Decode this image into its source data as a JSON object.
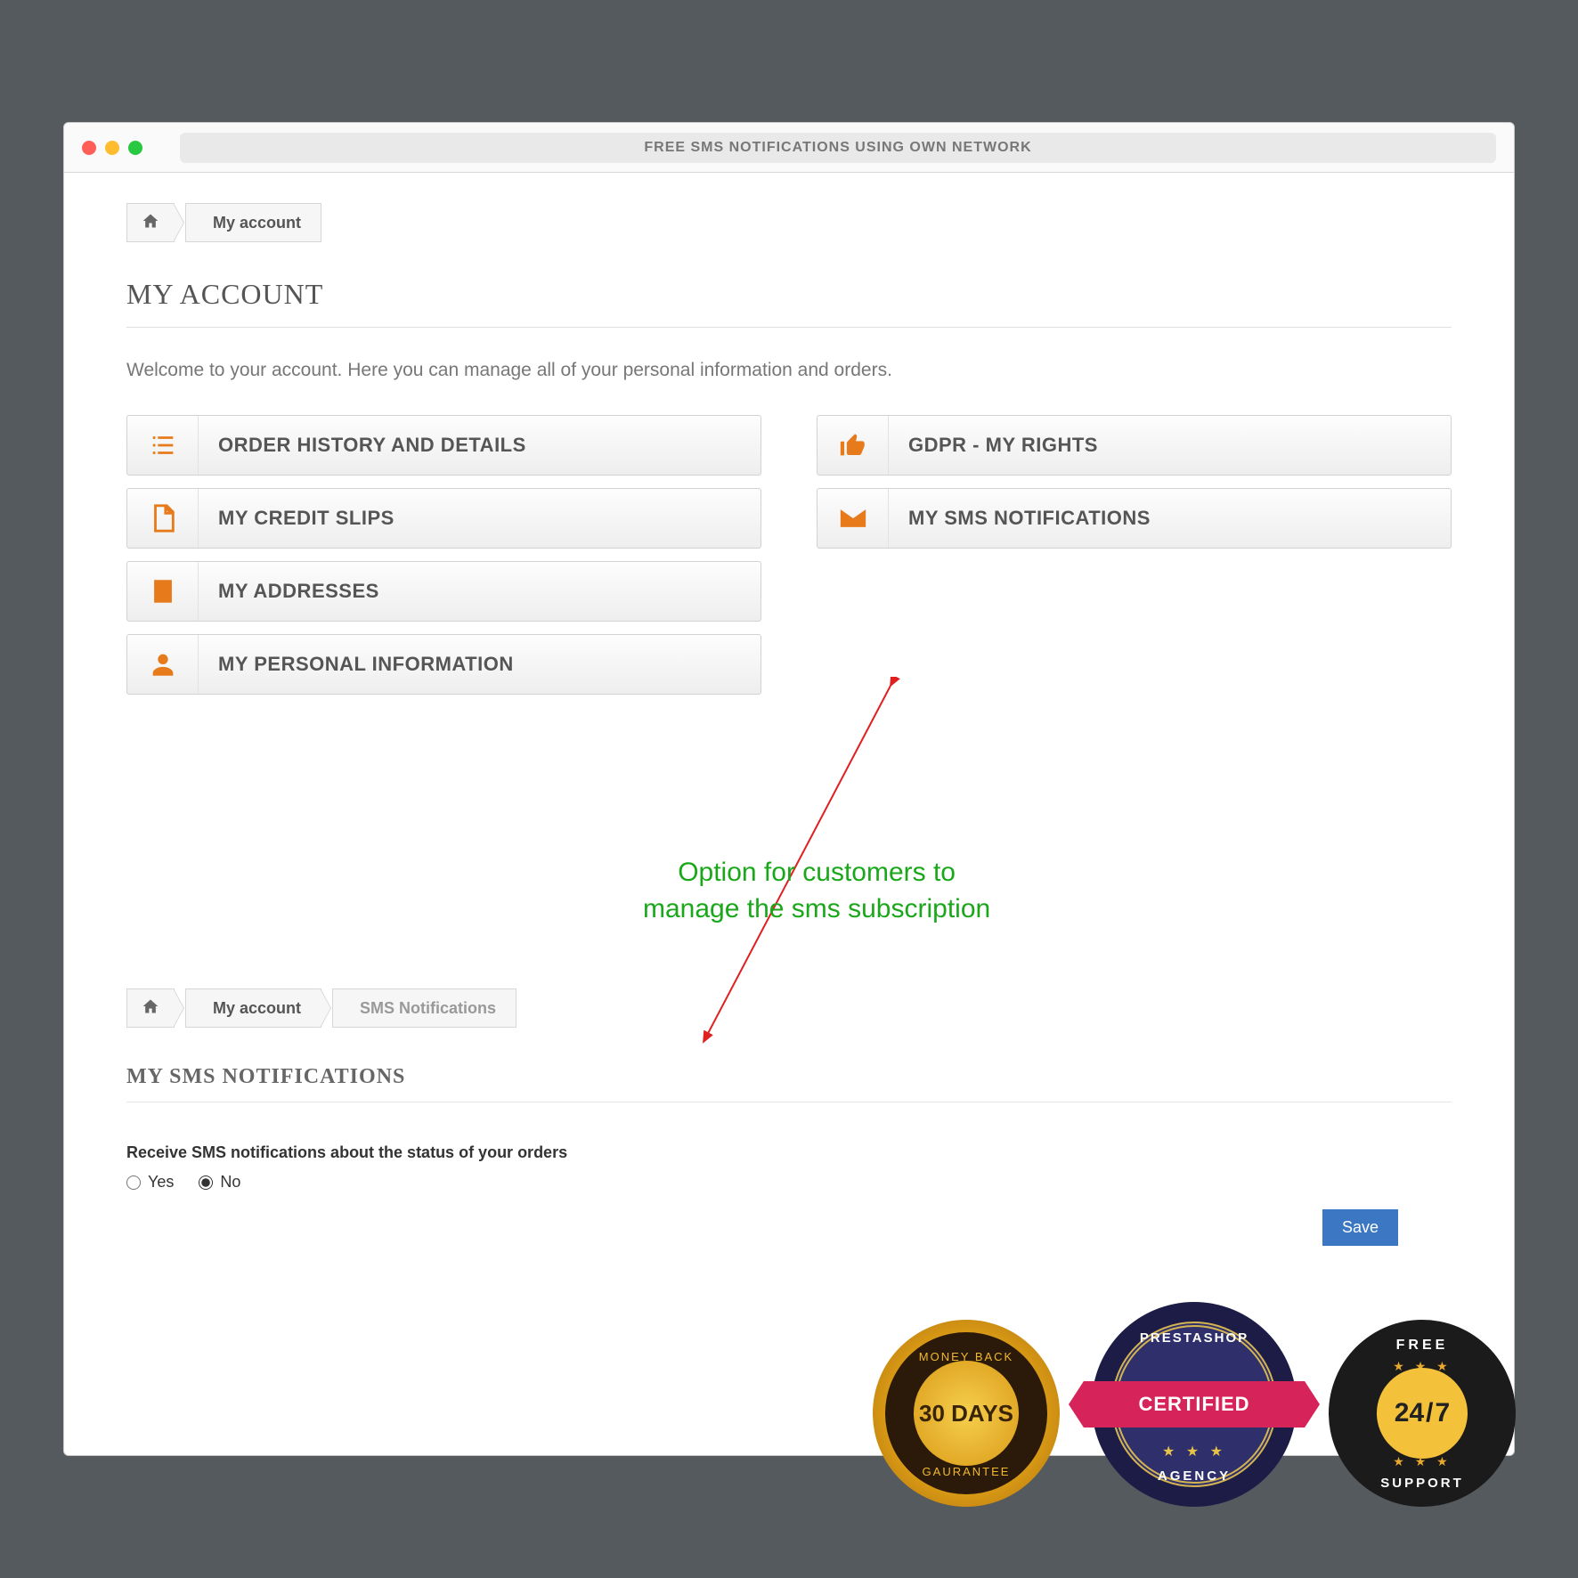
{
  "window": {
    "title": "FREE SMS NOTIFICATIONS USING OWN NETWORK"
  },
  "breadcrumb1": {
    "current": "My account"
  },
  "page1": {
    "title": "MY ACCOUNT",
    "welcome": "Welcome to your account. Here you can manage all of your personal information and orders."
  },
  "tiles": {
    "left": [
      {
        "label": "ORDER HISTORY AND DETAILS"
      },
      {
        "label": "MY CREDIT SLIPS"
      },
      {
        "label": "MY ADDRESSES"
      },
      {
        "label": "MY PERSONAL INFORMATION"
      }
    ],
    "right": [
      {
        "label": "GDPR - MY RIGHTS"
      },
      {
        "label": "MY SMS NOTIFICATIONS"
      }
    ]
  },
  "annotation": {
    "line1": "Option for customers to",
    "line2": "manage the sms subscription"
  },
  "breadcrumb2": {
    "parent": "My account",
    "current": "SMS Notifications"
  },
  "page2": {
    "title": "MY SMS NOTIFICATIONS",
    "formLabel": "Receive SMS notifications about the status of your orders",
    "optYes": "Yes",
    "optNo": "No",
    "selected": "No",
    "save": "Save"
  },
  "badges": {
    "gold": {
      "top": "MONEY BACK",
      "center1": "30 DAYS",
      "bottom": "GAURANTEE"
    },
    "cert": {
      "top": "PRESTASHOP",
      "ribbon": "CERTIFIED",
      "bottom": "AGENCY"
    },
    "support": {
      "top": "FREE",
      "center": "24/7",
      "bottom": "SUPPORT"
    }
  }
}
